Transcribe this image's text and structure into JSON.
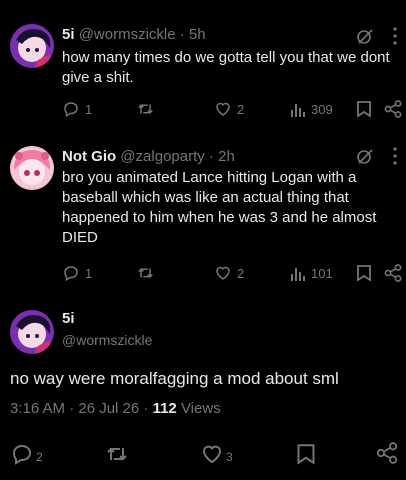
{
  "tweets": [
    {
      "name": "5i",
      "handle": "@wormszickle",
      "time": "· 5h",
      "text": "how many times do we gotta tell you that we dont give a shit.",
      "replies": "1",
      "likes": "2",
      "views": "309"
    },
    {
      "name": "Not Gio",
      "handle": "@zalgoparty",
      "time": "· 2h",
      "text": "bro you animated Lance hitting Logan with a baseball which was like an actual thing that happened to him when he was 3 and he almost DIED",
      "replies": "1",
      "likes": "2",
      "views": "101"
    }
  ],
  "main": {
    "name": "5i",
    "handle": "@wormszickle",
    "text": "no way were moralfagging a mod about sml",
    "timestamp": "3:16 AM · 26 Jul 26 · ",
    "views_count": "112",
    "views_label": " Views",
    "replies": "2",
    "likes": "3"
  },
  "icons": [
    "grok-icon",
    "more-icon",
    "reply-icon",
    "retweet-icon",
    "like-icon",
    "views-icon",
    "bookmark-icon",
    "share-icon"
  ],
  "colors": {
    "background": "#000000",
    "text": "#e7e9ea",
    "muted": "#71767b"
  }
}
